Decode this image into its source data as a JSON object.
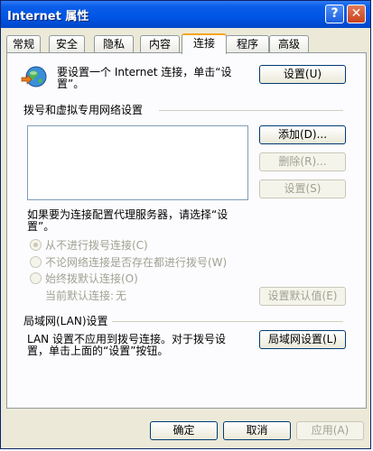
{
  "window": {
    "title": "Internet 属性"
  },
  "title_buttons": {
    "help": "?",
    "close": "✕"
  },
  "tabs": [
    {
      "label": "常规"
    },
    {
      "label": "安全"
    },
    {
      "label": "隐私"
    },
    {
      "label": "内容"
    },
    {
      "label": "连接"
    },
    {
      "label": "程序"
    },
    {
      "label": "高级"
    }
  ],
  "active_tab": "连接",
  "setup": {
    "text_line1": "要设置一个 Internet 连接，单击“设",
    "text_line2": "置”。",
    "button": "设置(U)"
  },
  "dialup": {
    "group_label": "拨号和虚拟专用网络设置",
    "add_button": "添加(D)...",
    "remove_button": "删除(R)...",
    "settings_button": "设置(S)",
    "proxy_text_line1": "如果要为连接配置代理服务器，请选择“设",
    "proxy_text_line2": "置”。",
    "options": [
      {
        "label": "从不进行拨号连接(C)",
        "selected": true
      },
      {
        "label": "不论网络连接是否存在都进行拨号(W)",
        "selected": false
      },
      {
        "label": "始终拨默认连接(O)",
        "selected": false
      }
    ],
    "current_default_label": "当前默认连接:",
    "current_default_value": "无",
    "set_default_button": "设置默认值(E)"
  },
  "lan": {
    "group_label": "局域网(LAN)设置",
    "text_line1": "LAN 设置不应用到拨号连接。对于拨号设",
    "text_line2": "置，单击上面的“设置”按钮。",
    "button": "局域网设置(L)"
  },
  "footer": {
    "ok": "确定",
    "cancel": "取消",
    "apply": "应用(A)"
  }
}
